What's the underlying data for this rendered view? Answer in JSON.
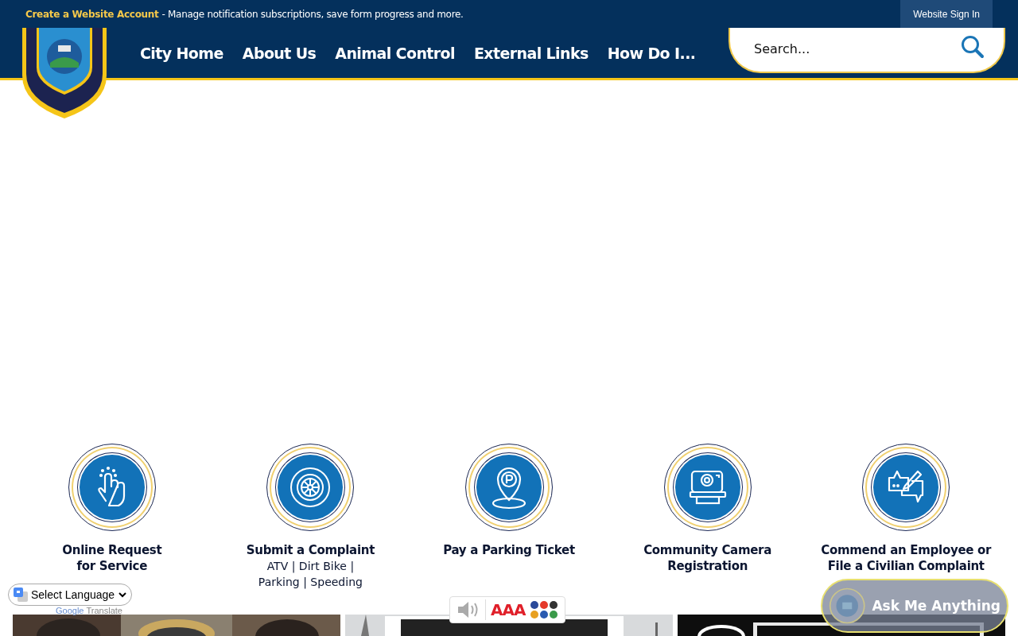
{
  "top_bar": {
    "account_link": "Create a Website Account",
    "message": "- Manage notification subscriptions, save form progress and more.",
    "sign_in": "Website Sign In"
  },
  "nav": [
    "City Home",
    "About Us",
    "Animal Control",
    "External Links",
    "How Do I..."
  ],
  "search": {
    "placeholder": "Search..."
  },
  "quick_links": [
    {
      "kind": "tap",
      "title": [
        "Online Request",
        "for Service"
      ]
    },
    {
      "kind": "wheel",
      "title": [
        "Submit a Complaint"
      ],
      "subtitle": [
        "ATV | Dirt Bike |",
        "Parking | Speeding"
      ]
    },
    {
      "kind": "parking",
      "title": [
        "Pay a Parking Ticket"
      ]
    },
    {
      "kind": "camera",
      "title": [
        "Community Camera",
        "Registration"
      ]
    },
    {
      "kind": "chat",
      "title": [
        "Commend an Employee or",
        "File a Civilian Complaint"
      ]
    }
  ],
  "language": {
    "value": "Select Language",
    "brand": "Google",
    "label": "Translate"
  },
  "accessibility": {
    "text_size": "AAA"
  },
  "assistant": {
    "label": "Ask Me Anything"
  }
}
